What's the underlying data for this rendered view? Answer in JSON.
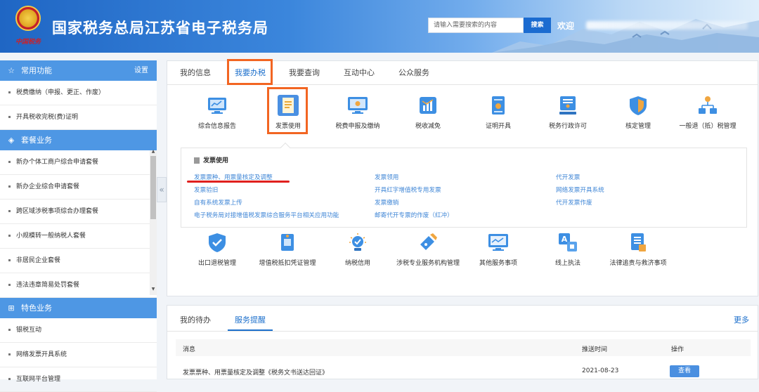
{
  "header": {
    "emblem_text": "中国税务",
    "title": "国家税务总局江苏省电子税务局",
    "search_placeholder": "请输入需要搜索的内容",
    "search_button": "搜索",
    "welcome": "欢迎"
  },
  "sidebar": {
    "sections": [
      {
        "title": "常用功能",
        "icon": "star-icon",
        "action": "设置",
        "items": [
          "税费缴纳（申报、更正、作废）",
          "开具税收完税(费)证明"
        ]
      },
      {
        "title": "套餐业务",
        "icon": "layers-icon",
        "items": [
          "新办个体工商户综合申请套餐",
          "新办企业综合申请套餐",
          "跨区域涉税事项综合办理套餐",
          "小规模转一般纳税人套餐",
          "非居民企业套餐",
          "违法违章简易处罚套餐"
        ]
      },
      {
        "title": "特色业务",
        "icon": "grid-icon",
        "items": [
          "银税互动",
          "网络发票开具系统",
          "互联网平台管理"
        ]
      }
    ],
    "collapse_icon": "«"
  },
  "main": {
    "tabs": [
      "我的信息",
      "我要办税",
      "我要查询",
      "互动中心",
      "公众服务"
    ],
    "active_tab": "我要办税",
    "row1": [
      {
        "label": "综合信息报告",
        "icon": "monitor-chart-icon"
      },
      {
        "label": "发票使用",
        "icon": "invoice-icon"
      },
      {
        "label": "税费申报及缴纳",
        "icon": "monitor-icon"
      },
      {
        "label": "税收减免",
        "icon": "chart-down-icon"
      },
      {
        "label": "证明开具",
        "icon": "certificate-icon"
      },
      {
        "label": "税务行政许可",
        "icon": "license-icon"
      },
      {
        "label": "核定管理",
        "icon": "shield-icon"
      },
      {
        "label": "一般退（抵）税管理",
        "icon": "org-chart-icon"
      }
    ],
    "panel": {
      "title": "发票使用",
      "col1": [
        "发票票种、用票量核定及调整",
        "发票验旧",
        "自有系统发票上传",
        "电子税务局对接增值税发票综合服务平台相关应用功能"
      ],
      "col2": [
        "发票领用",
        "开具红字增值税专用发票",
        "发票缴销",
        "邮寄代开专票的作废（红冲）"
      ],
      "col3": [
        "代开发票",
        "网络发票开具系统",
        "代开发票作废"
      ]
    },
    "row2": [
      {
        "label": "出口退税管理",
        "icon": "shield-check-icon"
      },
      {
        "label": "增值税抵扣凭证管理",
        "icon": "receipt-icon"
      },
      {
        "label": "纳税信用",
        "icon": "credit-badge-icon"
      },
      {
        "label": "涉税专业服务机构管理",
        "icon": "pen-tag-icon"
      },
      {
        "label": "其他服务事项",
        "icon": "monitor-line-icon"
      },
      {
        "label": "线上执法",
        "icon": "translate-icon"
      },
      {
        "label": "法律追责与救济事项",
        "icon": "document-list-icon"
      }
    ]
  },
  "bottom": {
    "tabs": [
      "我的待办",
      "服务提醒"
    ],
    "active_tab": "服务提醒",
    "more": "更多",
    "columns": [
      "消息",
      "推送时间",
      "操作"
    ],
    "rows": [
      {
        "message": "发票票种、用票量核定及调整《税务文书送达回证》",
        "time": "2021-08-23",
        "action": "查看"
      }
    ]
  },
  "colors": {
    "accent": "#1d70cc",
    "highlight": "#f26522",
    "underline": "#e0201e",
    "sidebar_head": "#4e97e4"
  }
}
